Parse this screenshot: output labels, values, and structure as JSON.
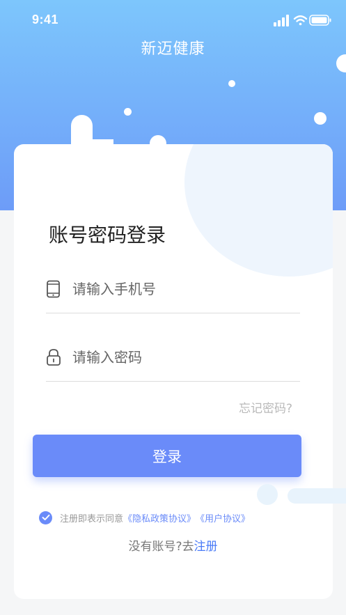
{
  "status_bar": {
    "time": "9:41",
    "icons": [
      "signal-icon",
      "wifi-icon",
      "battery-icon"
    ]
  },
  "header": {
    "app_title": "新迈健康"
  },
  "login": {
    "title": "账号密码登录",
    "phone_placeholder": "请输入手机号",
    "phone_value": "",
    "password_placeholder": "请输入密码",
    "password_value": "",
    "forgot_label": "忘记密码?",
    "submit_label": "登录"
  },
  "agreement": {
    "checked": true,
    "prefix": "注册即表示同意",
    "privacy_link": "《隐私政策协议》",
    "user_link": "《用户协议》"
  },
  "register": {
    "prompt": "没有账号?去",
    "link": "注册"
  },
  "colors": {
    "header_top": "#7dc6fc",
    "header_bottom": "#6d9cf8",
    "accent": "#6a8bf9",
    "link": "#4a7bf7"
  }
}
